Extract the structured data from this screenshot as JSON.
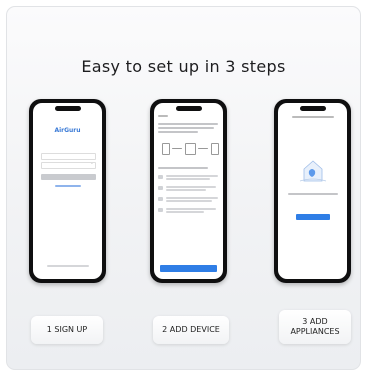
{
  "title": "Easy to set up in 3 steps",
  "steps": [
    {
      "label": "1 SIGN UP"
    },
    {
      "label": "2 ADD DEVICE"
    },
    {
      "label": "3 ADD\nAPPLIANCES"
    }
  ],
  "screens": {
    "signup": {
      "brand": "AirGuru"
    }
  },
  "colors": {
    "accent": "#2f7ee6",
    "phone": "#0f0f10"
  }
}
